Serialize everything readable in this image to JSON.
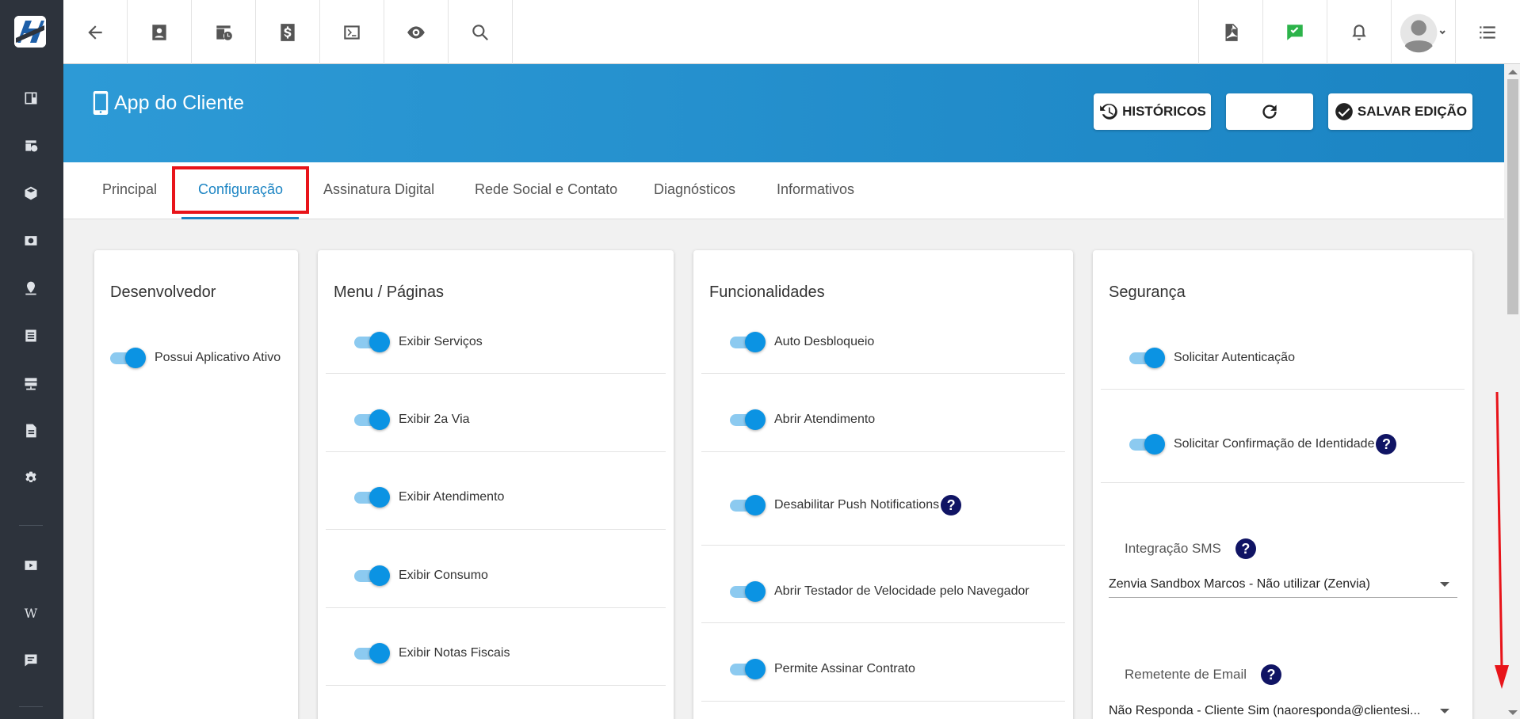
{
  "sidebar": {
    "icons": [
      "dashboard-icon",
      "calendar-clock-icon",
      "box-icon",
      "money-icon",
      "location-icon",
      "list-icon",
      "server-icon",
      "document-icon",
      "gear-icon",
      "video-icon",
      "wiki-icon",
      "chat-icon"
    ],
    "wiki_glyph": "W"
  },
  "topbar": {
    "left_icons": [
      "back-arrow-icon",
      "contact-card-icon",
      "calendar-clock-icon",
      "dollar-icon",
      "terminal-icon",
      "eye-icon",
      "search-icon"
    ],
    "right_icons": [
      "pdf-icon",
      "check-message-icon",
      "bell-icon",
      "avatar",
      "menu-list-icon"
    ]
  },
  "header": {
    "title": "App do Cliente",
    "buttons": {
      "history": "HISTÓRICOS",
      "refresh": "",
      "save": "SALVAR EDIÇÃO"
    }
  },
  "tabs": [
    {
      "label": "Principal",
      "active": false
    },
    {
      "label": "Configuração",
      "active": true
    },
    {
      "label": "Assinatura Digital",
      "active": false
    },
    {
      "label": "Rede Social e Contato",
      "active": false
    },
    {
      "label": "Diagnósticos",
      "active": false
    },
    {
      "label": "Informativos",
      "active": false
    }
  ],
  "cards": {
    "developer": {
      "title": "Desenvolvedor",
      "items": [
        "Possui Aplicativo Ativo"
      ]
    },
    "menu": {
      "title": "Menu / Páginas",
      "items": [
        "Exibir Serviços",
        "Exibir 2a Via",
        "Exibir Atendimento",
        "Exibir Consumo",
        "Exibir Notas Fiscais"
      ]
    },
    "features": {
      "title": "Funcionalidades",
      "items": [
        "Auto Desbloqueio",
        "Abrir Atendimento",
        "Desabilitar Push Notifications",
        "Abrir Testador de Velocidade pelo Navegador",
        "Permite Assinar Contrato"
      ]
    },
    "security": {
      "title": "Segurança",
      "items": [
        "Solicitar Autenticação",
        "Solicitar Confirmação de Identidade"
      ],
      "sms_label": "Integração SMS",
      "sms_value": "Zenvia Sandbox Marcos - Não utilizar (Zenvia)",
      "email_label": "Remetente de Email",
      "email_value": "Não Responda - Cliente Sim (naoresponda@clientesi..."
    }
  },
  "help_glyph": "?",
  "colors": {
    "banner": "#1b84c3",
    "sidebar": "#2d333c",
    "toggle_on": "#0b93e3",
    "help": "#101464",
    "highlight": "#e8141a"
  }
}
